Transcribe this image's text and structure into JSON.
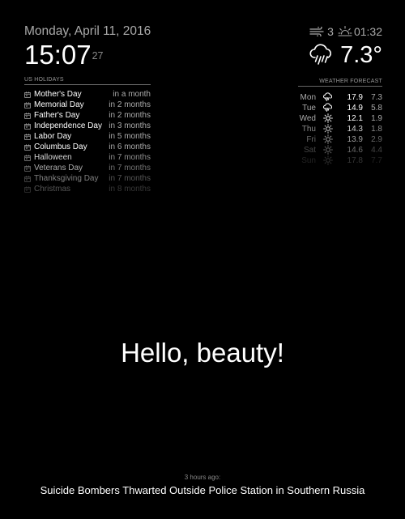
{
  "clock": {
    "date": "Monday, April 11, 2016",
    "time": "15:07",
    "seconds": "27"
  },
  "holidays": {
    "header": "US HOLIDAYS",
    "icon": "calendar-icon",
    "items": [
      {
        "name": "Mother's Day",
        "when": "in a month"
      },
      {
        "name": "Memorial Day",
        "when": "in 2 months"
      },
      {
        "name": "Father's Day",
        "when": "in 2 months"
      },
      {
        "name": "Independence Day",
        "when": "in 3 months"
      },
      {
        "name": "Labor Day",
        "when": "in 5 months"
      },
      {
        "name": "Columbus Day",
        "when": "in 6 months"
      },
      {
        "name": "Halloween",
        "when": "in 7 months"
      },
      {
        "name": "Veterans Day",
        "when": "in 7 months"
      },
      {
        "name": "Thanksgiving Day",
        "when": "in 7 months"
      },
      {
        "name": "Christmas",
        "when": "in 8 months"
      }
    ]
  },
  "current_weather": {
    "wind_icon": "wind-icon",
    "wind_speed": "3",
    "sunrise_icon": "sunrise-icon",
    "sun_time": "01:32",
    "condition_icon": "rain-cloud-icon",
    "temperature": "7.3°"
  },
  "forecast": {
    "header": "WEATHER FORECAST",
    "days": [
      {
        "day": "Mon",
        "icon": "rain-cloud-icon",
        "max": "17.9",
        "min": "7.3"
      },
      {
        "day": "Tue",
        "icon": "rain-cloud-icon",
        "max": "14.9",
        "min": "5.8"
      },
      {
        "day": "Wed",
        "icon": "sun-icon",
        "max": "12.1",
        "min": "1.9"
      },
      {
        "day": "Thu",
        "icon": "sun-icon",
        "max": "14.3",
        "min": "1.8"
      },
      {
        "day": "Fri",
        "icon": "sun-icon",
        "max": "13.9",
        "min": "2.9"
      },
      {
        "day": "Sat",
        "icon": "sun-icon",
        "max": "14.6",
        "min": "4.4"
      },
      {
        "day": "Sun",
        "icon": "sun-icon",
        "max": "17.8",
        "min": "7.7"
      }
    ]
  },
  "compliment": {
    "text": "Hello, beauty!"
  },
  "newsfeed": {
    "ago": "3 hours ago:",
    "headline": "Suicide Bombers Thwarted Outside Police Station in Southern Russia"
  },
  "colors": {
    "background": "#000000",
    "bright": "#ffffff",
    "normal": "#aaaaaa",
    "dimmed": "#888888"
  }
}
